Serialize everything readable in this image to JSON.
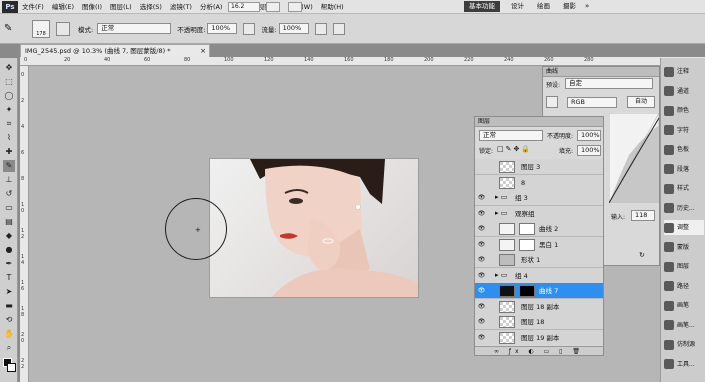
{
  "app": {
    "logo": "Ps",
    "zoom_box": "16.2"
  },
  "menus": [
    "文件(F)",
    "编辑(E)",
    "图像(I)",
    "图层(L)",
    "选择(S)",
    "滤镜(T)",
    "分析(A)",
    "3D(D)",
    "视图(V)",
    "窗口(W)",
    "帮助(H)"
  ],
  "workspaces": [
    "基本功能",
    "设计",
    "绘画",
    "摄影"
  ],
  "options": {
    "brush_size": "178",
    "mode_label": "模式:",
    "mode_value": "正常",
    "opacity_label": "不透明度:",
    "opacity_value": "100%",
    "flow_label": "流量:",
    "flow_value": "100%"
  },
  "document": {
    "tab_title": "IMG_2545.psd @ 10.3% (曲线 7, 图层蒙版/8) *",
    "close": "×"
  },
  "ruler_h": [
    "0",
    "20",
    "40",
    "60",
    "80",
    "100",
    "120",
    "140",
    "160",
    "180",
    "200",
    "220",
    "240",
    "260",
    "280"
  ],
  "ruler_v": [
    "0",
    "2",
    "4",
    "6",
    "8",
    "1 0",
    "1 2",
    "1 4",
    "1 6",
    "1 8",
    "2 0",
    "2 2"
  ],
  "curves": {
    "title": "曲线",
    "preset_label": "预设:",
    "preset_value": "自定",
    "channel": "RGB",
    "auto_button": "自动",
    "input_label": "输入:",
    "input_value": "118"
  },
  "layers": {
    "title": "图层",
    "blend_mode": "正常",
    "opacity_label": "不透明度:",
    "opacity_value": "100%",
    "lock_label": "锁定:",
    "fill_label": "填充:",
    "fill_value": "100%",
    "rows": [
      {
        "name": "图层 3",
        "kind": "pixel"
      },
      {
        "name": "8",
        "kind": "pixel"
      },
      {
        "name": "组 3",
        "kind": "group"
      },
      {
        "name": "观察组",
        "kind": "group"
      },
      {
        "name": "曲线 2",
        "kind": "adjust"
      },
      {
        "name": "黑白 1",
        "kind": "adjust"
      },
      {
        "name": "形状 1",
        "kind": "shape"
      },
      {
        "name": "组 4",
        "kind": "group"
      },
      {
        "name": "曲线 7",
        "kind": "adjust",
        "selected": true
      },
      {
        "name": "图层 18 副本",
        "kind": "pixel"
      },
      {
        "name": "图层 18",
        "kind": "pixel"
      },
      {
        "name": "图层 19 副本",
        "kind": "pixel"
      }
    ]
  },
  "dock": [
    "注释",
    "通道",
    "颜色",
    "字符",
    "色板",
    "段落",
    "样式",
    "历史...",
    "调整",
    "蒙版",
    "图层",
    "路径",
    "画笔",
    "画笔...",
    "仿制源",
    "工具..."
  ],
  "colors": {
    "accent": "#2f8ff0",
    "workspace_bg": "#b6b6b6"
  }
}
